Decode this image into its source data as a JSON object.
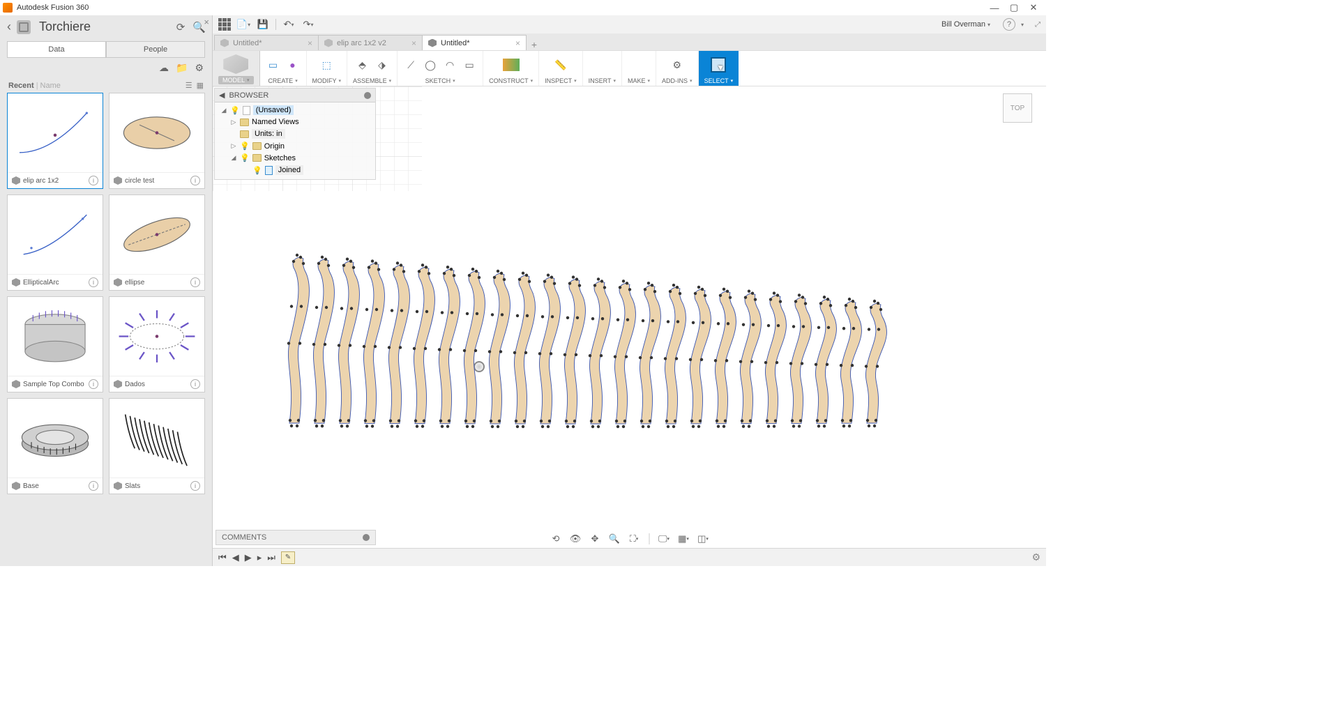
{
  "titlebar": {
    "app_name": "Autodesk Fusion 360"
  },
  "qa": {
    "user": "Bill Overman"
  },
  "data_panel": {
    "title": "Torchiere",
    "tabs": {
      "data": "Data",
      "people": "People"
    },
    "recent_label": "Recent",
    "name_label": "Name",
    "cards": [
      {
        "label": "elip arc 1x2"
      },
      {
        "label": "circle test"
      },
      {
        "label": "EllipticalArc"
      },
      {
        "label": "ellipse"
      },
      {
        "label": "Sample Top Combo"
      },
      {
        "label": "Dados"
      },
      {
        "label": "Base"
      },
      {
        "label": "Slats"
      }
    ]
  },
  "doc_tabs": [
    {
      "label": "Untitled*",
      "active": false
    },
    {
      "label": "elip arc 1x2 v2",
      "active": false
    },
    {
      "label": "Untitled*",
      "active": true
    }
  ],
  "toolbar": {
    "model": "MODEL",
    "create": "CREATE",
    "modify": "MODIFY",
    "assemble": "ASSEMBLE",
    "sketch": "SKETCH",
    "construct": "CONSTRUCT",
    "inspect": "INSPECT",
    "insert": "INSERT",
    "make": "MAKE",
    "addins": "ADD-INS",
    "select": "SELECT"
  },
  "browser": {
    "header": "BROWSER",
    "root": "(Unsaved)",
    "named_views": "Named Views",
    "units": "Units: in",
    "origin": "Origin",
    "sketches": "Sketches",
    "joined": "Joined"
  },
  "viewcube": "TOP",
  "comments": "COMMENTS"
}
